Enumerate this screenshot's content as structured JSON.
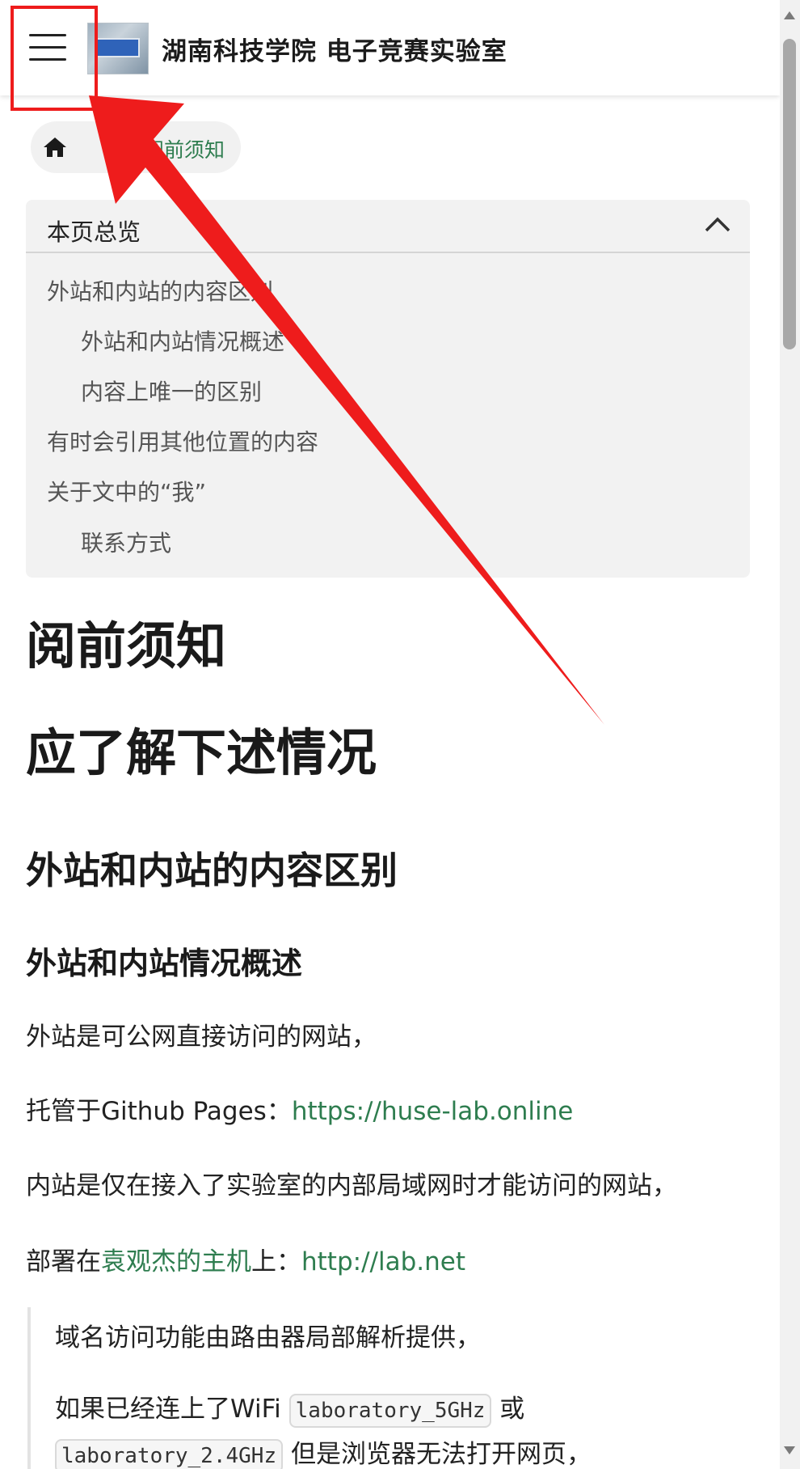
{
  "header": {
    "site_title": "湖南科技学院 电子竞赛实验室",
    "menu_icon": "hamburger-menu-icon",
    "logo_alt": "site-logo"
  },
  "breadcrumb": {
    "home_icon": "home-icon",
    "current": "阅前须知"
  },
  "toc": {
    "title": "本页总览",
    "collapse_icon": "chevron-up-icon",
    "items": [
      {
        "label": "外站和内站的内容区别",
        "level": 1
      },
      {
        "label": "外站和内站情况概述",
        "level": 2
      },
      {
        "label": "内容上唯一的区别",
        "level": 2
      },
      {
        "label": "有时会引用其他位置的内容",
        "level": 1
      },
      {
        "label": "关于文中的“我”",
        "level": 1
      },
      {
        "label": "联系方式",
        "level": 2
      }
    ]
  },
  "content": {
    "page_title": "阅前须知",
    "section_title": "应了解下述情况",
    "h2_1": "外站和内站的内容区别",
    "h3_1": "外站和内站情况概述",
    "p1": "外站是可公网直接访问的网站，",
    "p2_prefix": "托管于Github Pages：",
    "p2_link": "https://huse-lab.online",
    "p3": "内站是仅在接入了实验室的内部局域网时才能访问的网站，",
    "p4_prefix": "部署在",
    "p4_link1": "袁观杰的主机",
    "p4_mid": "上：",
    "p4_link2": "http://lab.net",
    "quote_p1": "域名访问功能由路由器局部解析提供，",
    "quote_p2_prefix": "如果已经连上了WiFi ",
    "quote_code1": "laboratory_5GHz",
    "quote_p2_mid": " 或",
    "quote_code2": "laboratory_2.4GHz",
    "quote_p2_suffix": " 但是浏览器无法打开网页，"
  },
  "annotation": {
    "color": "#ee1c1c"
  },
  "colors": {
    "link": "#2e7d4f",
    "toc_bg": "#f2f2f2",
    "breadcrumb_bg": "#f1f1f1"
  }
}
